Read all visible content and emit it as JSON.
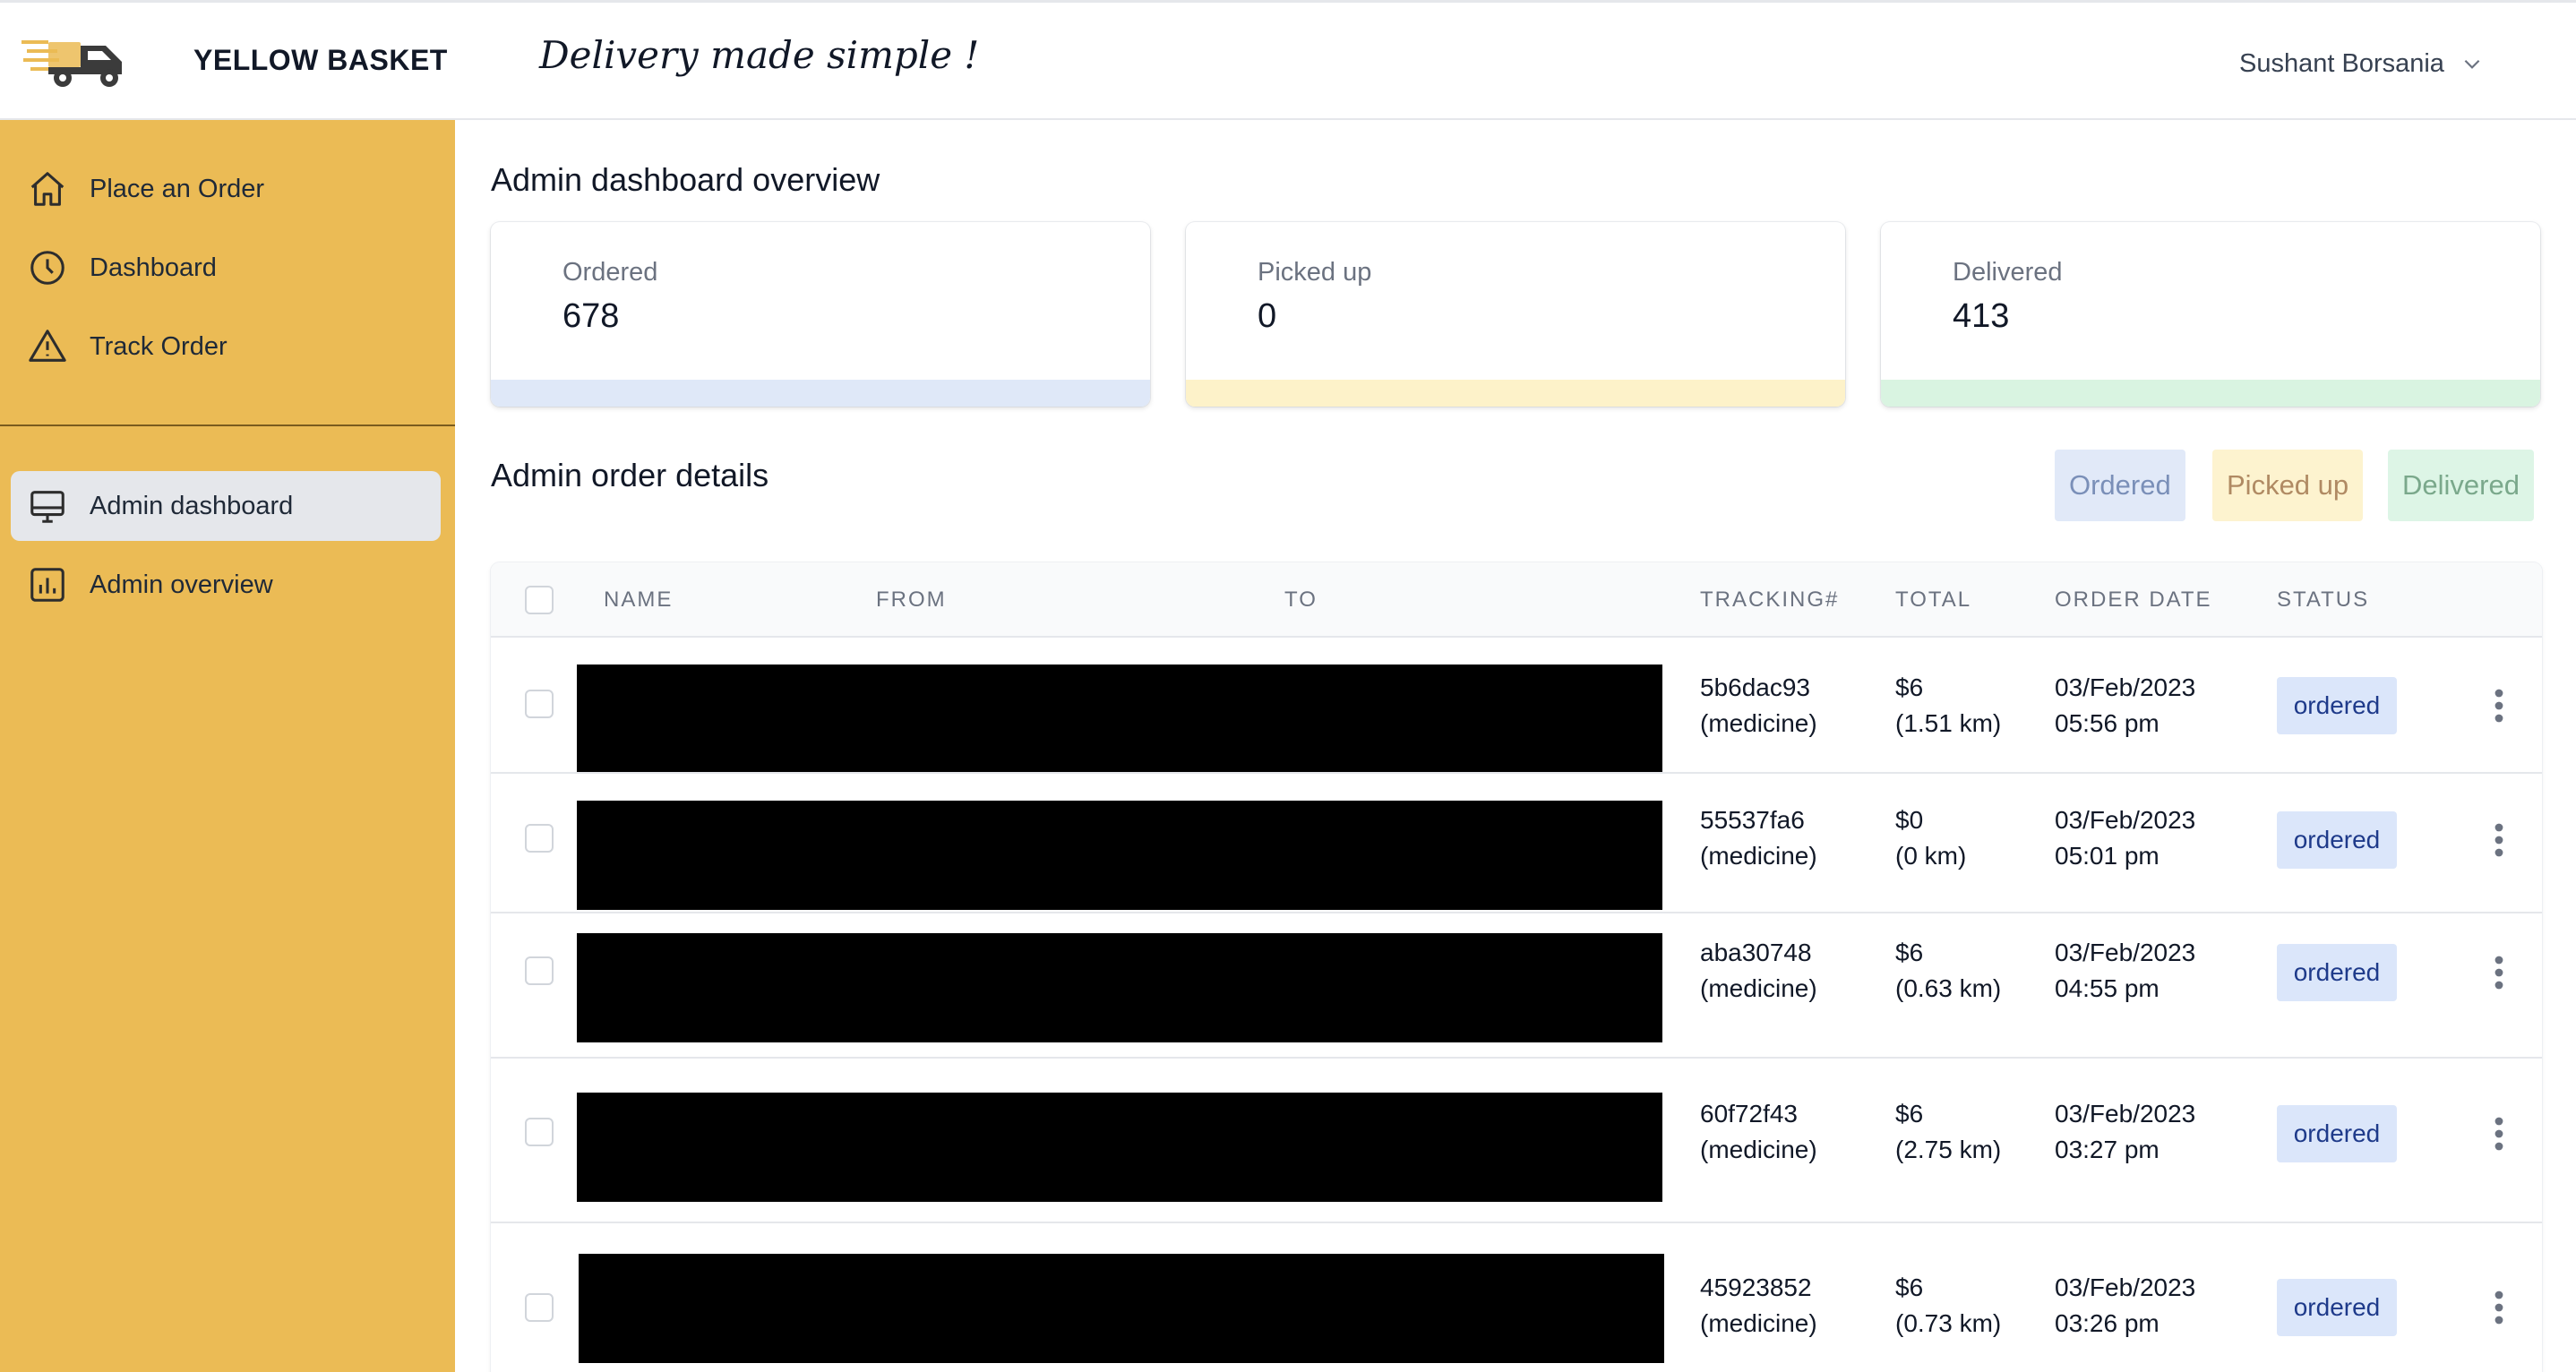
{
  "header": {
    "brand": "YELLOW BASKET",
    "tagline": "Delivery made simple !",
    "user_name": "Sushant Borsania",
    "logo_icon": "delivery-truck-icon"
  },
  "sidebar": {
    "primary": [
      {
        "label": "Place an Order",
        "icon": "home-icon"
      },
      {
        "label": "Dashboard",
        "icon": "clock-icon"
      },
      {
        "label": "Track Order",
        "icon": "warning-triangle-icon"
      }
    ],
    "admin": [
      {
        "label": "Admin dashboard",
        "icon": "desktop-icon",
        "active": true
      },
      {
        "label": "Admin overview",
        "icon": "bar-chart-icon",
        "active": false
      }
    ]
  },
  "overview": {
    "title": "Admin dashboard overview",
    "cards": [
      {
        "label": "Ordered",
        "value": "678",
        "color": "#dfe8f8"
      },
      {
        "label": "Picked up",
        "value": "0",
        "color": "#fdf2c9"
      },
      {
        "label": "Delivered",
        "value": "413",
        "color": "#d9f4e1"
      }
    ]
  },
  "details": {
    "title": "Admin order details",
    "legend": [
      {
        "label": "Ordered",
        "bg": "#e1e9f8",
        "fg": "#7a8fb8"
      },
      {
        "label": "Picked up",
        "bg": "#fdf3cf",
        "fg": "#b08a63"
      },
      {
        "label": "Delivered",
        "bg": "#ddf5e6",
        "fg": "#7aa88b"
      }
    ]
  },
  "table": {
    "headers": [
      "NAME",
      "FROM",
      "TO",
      "TRACKING#",
      "TOTAL",
      "ORDER DATE",
      "STATUS"
    ],
    "rows": [
      {
        "tracking": "5b6dac93",
        "category": "(medicine)",
        "total": "$6",
        "distance": "(1.51 km)",
        "date": "03/Feb/2023",
        "time": "05:56 pm",
        "status": "ordered"
      },
      {
        "tracking": "55537fa6",
        "category": "(medicine)",
        "total": "$0",
        "distance": "(0 km)",
        "date": "03/Feb/2023",
        "time": "05:01 pm",
        "status": "ordered"
      },
      {
        "tracking": "aba30748",
        "category": "(medicine)",
        "total": "$6",
        "distance": "(0.63 km)",
        "date": "03/Feb/2023",
        "time": "04:55 pm",
        "status": "ordered"
      },
      {
        "tracking": "60f72f43",
        "category": "(medicine)",
        "total": "$6",
        "distance": "(2.75 km)",
        "date": "03/Feb/2023",
        "time": "03:27 pm",
        "status": "ordered"
      },
      {
        "tracking": "45923852",
        "category": "(medicine)",
        "total": "$6",
        "distance": "(0.73 km)",
        "date": "03/Feb/2023",
        "time": "03:26 pm",
        "status": "ordered"
      }
    ]
  }
}
